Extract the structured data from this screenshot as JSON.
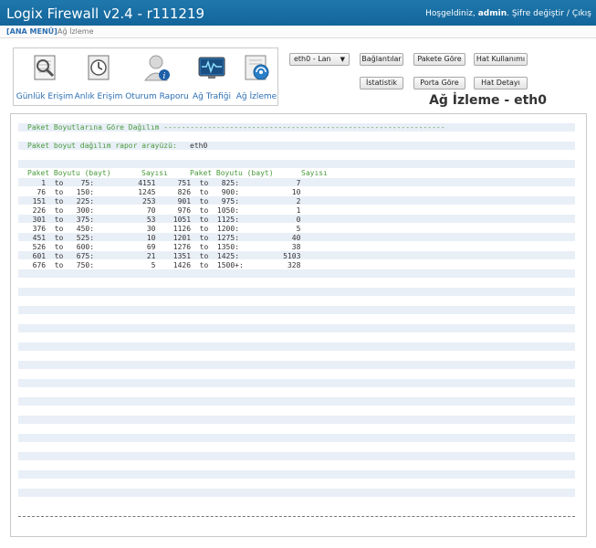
{
  "header": {
    "title": "Logix Firewall v2.4 - r111219",
    "welcome": "Hoşgeldiniz,",
    "user": "admin",
    "change_password": "Şifre değiştir",
    "separator": "/",
    "logout": "Çıkış"
  },
  "breadcrumb": {
    "home": "[ANA MENÜ]",
    "sep": "›",
    "current": "Ağ İzleme"
  },
  "nav": {
    "items": [
      {
        "label": "Günlük Erişim",
        "icon": "daily-log-icon"
      },
      {
        "label": "Anlık Erişim",
        "icon": "realtime-icon"
      },
      {
        "label": "Oturum Raporu",
        "icon": "user-info-icon"
      },
      {
        "label": "Ağ Trafiği",
        "icon": "monitor-icon"
      },
      {
        "label": "Ağ İzleme",
        "icon": "network-monitor-icon"
      }
    ]
  },
  "controls": {
    "interface_select": "eth0 - Lan",
    "buttons": [
      "Bağlantılar",
      "Pakete Göre",
      "Hat Kullanımı",
      "İstatistik",
      "Porta Göre",
      "Hat Detayı"
    ]
  },
  "page_title": "Ağ İzleme - eth0",
  "report": {
    "heading": "Paket Boyutlarına Göre Dağılım ----------------------------------------------------------------",
    "interface_label": "Paket boyut dağılım rapor arayüzü:",
    "interface_value": "eth0",
    "col_headers": [
      "Paket Boyutu (bayt)",
      "Sayısı",
      "Paket Boyutu (bayt)",
      "Sayısı"
    ],
    "rows": [
      "    1  to    75:          4151     751  to   825:             7",
      "   76  to   150:          1245     826  to   900:            10",
      "  151  to   225:           253     901  to   975:             2",
      "  226  to   300:            70     976  to  1050:             1",
      "  301  to   375:            53    1051  to  1125:             0",
      "  376  to   450:            30    1126  to  1200:             5",
      "  451  to   525:            10    1201  to  1275:            40",
      "  526  to   600:            69    1276  to  1350:            38",
      "  601  to   675:            21    1351  to  1425:          5103",
      "  676  to   750:             5    1426  to  1500+:          328"
    ]
  }
}
